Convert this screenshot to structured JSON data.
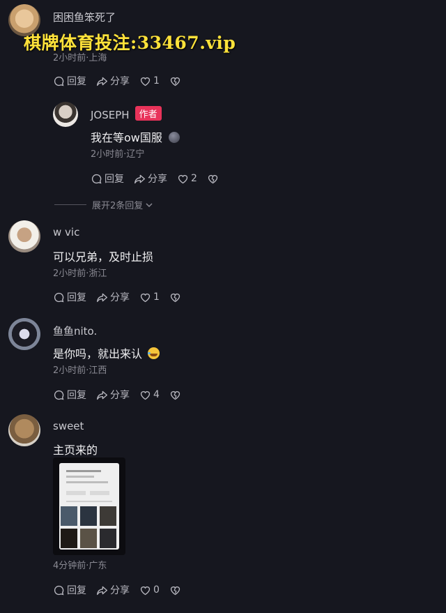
{
  "watermark": "棋牌体育投注:33467.vip",
  "comments": [
    {
      "user": "困困鱼笨死了",
      "meta": "2小时前·上海",
      "reply_label": "回复",
      "share_label": "分享",
      "likes": "1"
    },
    {
      "user": "JOSEPH",
      "tag": "作者",
      "text": "我在等ow国服",
      "meta": "2小时前·辽宁",
      "reply_label": "回复",
      "share_label": "分享",
      "likes": "2"
    },
    {
      "user": "w vic",
      "text": "可以兄弟，及时止损",
      "meta": "2小时前·浙江",
      "reply_label": "回复",
      "share_label": "分享",
      "likes": "1"
    },
    {
      "user": "鱼鱼nito.",
      "text": "是你吗，就出来认",
      "meta": "2小时前·江西",
      "reply_label": "回复",
      "share_label": "分享",
      "likes": "4"
    },
    {
      "user": "sweet",
      "text": "主页来的",
      "meta": "4分钟前·广东",
      "reply_label": "回复",
      "share_label": "分享",
      "likes": "0"
    }
  ],
  "expand_replies": "展开2条回复",
  "colors": {
    "background": "#16171f",
    "author_tag": "#e8335a",
    "watermark": "#ffe23a"
  },
  "icons": [
    "comment-bubble-icon",
    "share-arrow-icon",
    "heart-icon",
    "dislike-heart-icon",
    "emoji-icon",
    "chevron-down-icon"
  ]
}
